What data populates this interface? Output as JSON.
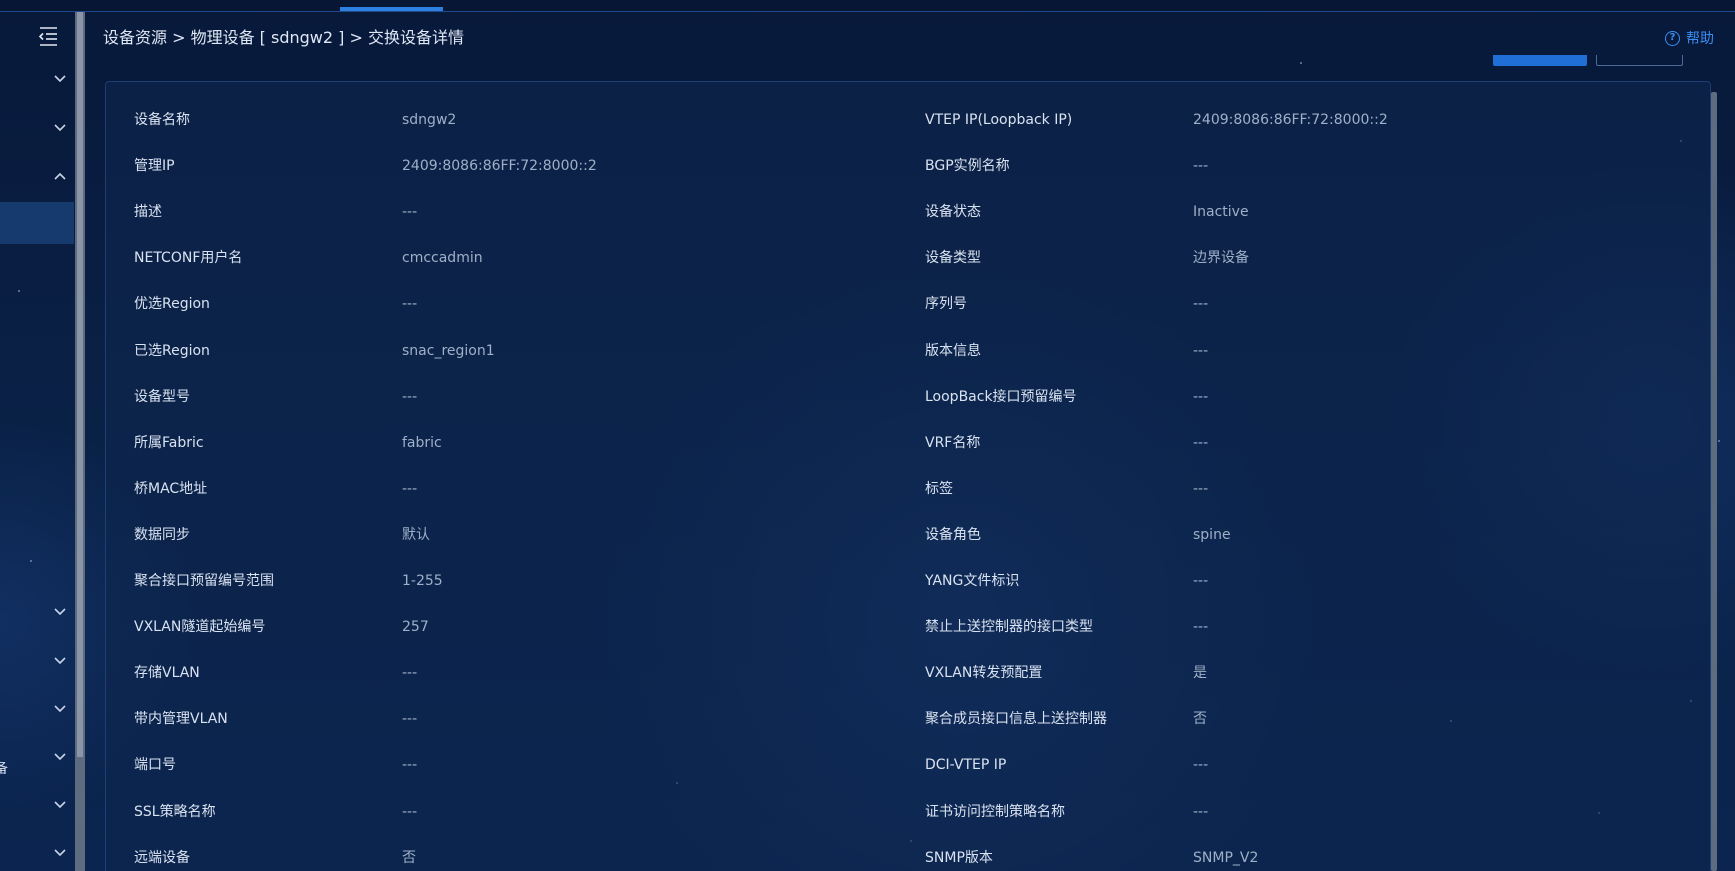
{
  "breadcrumb": "设备资源 > 物理设备 [ sdngw2 ] > 交换设备详情",
  "help": {
    "label": "帮助"
  },
  "sidebar": {
    "stray_char": "备"
  },
  "details": [
    {
      "left_label": "设备名称",
      "left_value": "sdngw2",
      "right_label": "VTEP IP(Loopback IP)",
      "right_value": "2409:8086:86FF:72:8000::2"
    },
    {
      "left_label": "管理IP",
      "left_value": "2409:8086:86FF:72:8000::2",
      "right_label": "BGP实例名称",
      "right_value": "---"
    },
    {
      "left_label": "描述",
      "left_value": "---",
      "right_label": "设备状态",
      "right_value": "Inactive"
    },
    {
      "left_label": "NETCONF用户名",
      "left_value": "cmccadmin",
      "right_label": "设备类型",
      "right_value": "边界设备"
    },
    {
      "left_label": "优选Region",
      "left_value": "---",
      "right_label": "序列号",
      "right_value": "---"
    },
    {
      "left_label": "已选Region",
      "left_value": "snac_region1",
      "right_label": "版本信息",
      "right_value": "---"
    },
    {
      "left_label": "设备型号",
      "left_value": "---",
      "right_label": "LoopBack接口预留编号",
      "right_value": "---"
    },
    {
      "left_label": "所属Fabric",
      "left_value": "fabric",
      "right_label": "VRF名称",
      "right_value": "---"
    },
    {
      "left_label": "桥MAC地址",
      "left_value": "---",
      "right_label": "标签",
      "right_value": "---"
    },
    {
      "left_label": "数据同步",
      "left_value": "默认",
      "right_label": "设备角色",
      "right_value": "spine"
    },
    {
      "left_label": "聚合接口预留编号范围",
      "left_value": "1-255",
      "right_label": "YANG文件标识",
      "right_value": "---"
    },
    {
      "left_label": "VXLAN隧道起始编号",
      "left_value": "257",
      "right_label": "禁止上送控制器的接口类型",
      "right_value": "---"
    },
    {
      "left_label": "存储VLAN",
      "left_value": "---",
      "right_label": "VXLAN转发预配置",
      "right_value": "是"
    },
    {
      "left_label": "带内管理VLAN",
      "left_value": "---",
      "right_label": "聚合成员接口信息上送控制器",
      "right_value": "否"
    },
    {
      "left_label": "端口号",
      "left_value": "---",
      "right_label": "DCI-VTEP IP",
      "right_value": "---"
    },
    {
      "left_label": "SSL策略名称",
      "left_value": "---",
      "right_label": "证书访问控制策略名称",
      "right_value": "---"
    },
    {
      "left_label": "远端设备",
      "left_value": "否",
      "right_label": "SNMP版本",
      "right_value": "SNMP_V2"
    }
  ]
}
